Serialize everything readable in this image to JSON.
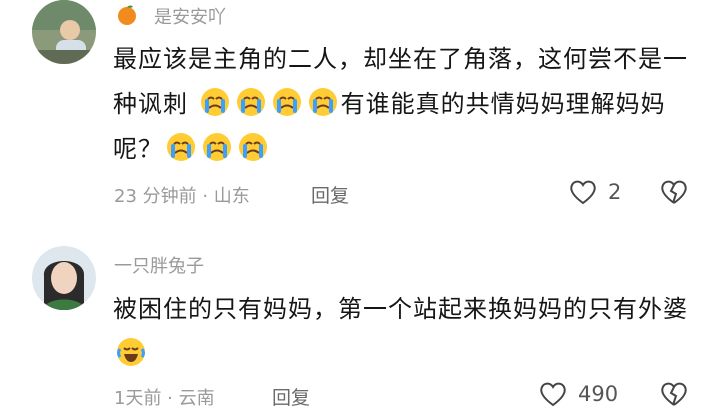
{
  "comments": [
    {
      "username": "是安安吖",
      "text_1": "最应该是主角的二人，却坐在了角落，这何尝不是一种讽刺",
      "text_2": "有谁能真的共情妈妈理解妈妈呢？",
      "time": "23 分钟前 · 山东",
      "reply": "回复",
      "likes": "2",
      "emojis": [
        "crying-emoji",
        "crying-emoji",
        "crying-emoji",
        "crying-emoji",
        "crying-emoji",
        "crying-emoji",
        "crying-emoji"
      ]
    },
    {
      "username": "一只胖兔子",
      "text_1": "被困住的只有妈妈，第一个站起来换妈妈的只有外婆",
      "time": "1天前 · 云南",
      "reply": "回复",
      "likes": "490",
      "emojis": [
        "laugh-cry-emoji"
      ]
    }
  ],
  "colors": {
    "meta": "#9a9a9a",
    "text": "#161616",
    "emoji_face": "#ffcc33",
    "emoji_tear": "#3aa0ff"
  }
}
